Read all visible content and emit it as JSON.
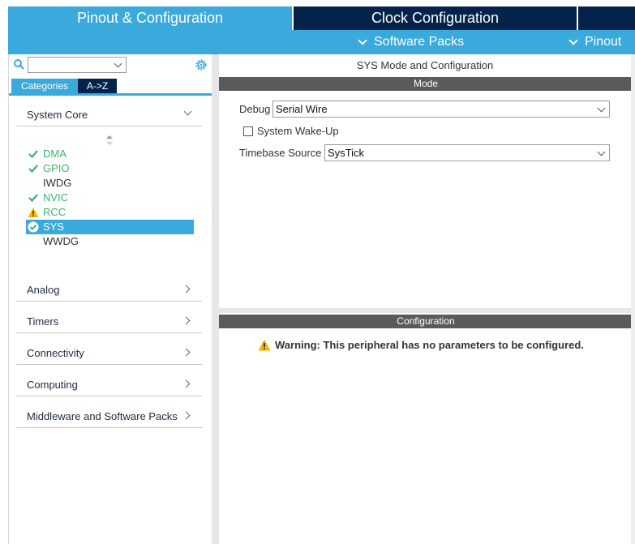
{
  "top_tabs": {
    "pinout": "Pinout & Configuration",
    "clock": "Clock Configuration"
  },
  "sub_menu": {
    "software_packs": "Software Packs",
    "pinout": "Pinout"
  },
  "left": {
    "search": {
      "value": ""
    },
    "tabs": {
      "categories": "Categories",
      "az": "A->Z"
    },
    "sections": {
      "system_core": "System Core",
      "analog": "Analog",
      "timers": "Timers",
      "connectivity": "Connectivity",
      "computing": "Computing",
      "middleware": "Middleware and Software Packs"
    },
    "peripherals": [
      {
        "name": "DMA",
        "status": "ok"
      },
      {
        "name": "GPIO",
        "status": "ok"
      },
      {
        "name": "IWDG",
        "status": "none"
      },
      {
        "name": "NVIC",
        "status": "ok"
      },
      {
        "name": "RCC",
        "status": "warning"
      },
      {
        "name": "SYS",
        "status": "selected-ok"
      },
      {
        "name": "WWDG",
        "status": "none"
      }
    ]
  },
  "right": {
    "title": "SYS Mode and Configuration",
    "mode_band": "Mode",
    "debug_label": "Debug",
    "debug_value": "Serial Wire",
    "wakeup_label": "System Wake-Up",
    "wakeup_checked": false,
    "timebase_label": "Timebase Source",
    "timebase_value": "SysTick",
    "config_band": "Configuration",
    "warning": "Warning: This peripheral has no parameters to be configured."
  },
  "colors": {
    "accent": "#3aa9db",
    "navy": "#03234b",
    "ok_green": "#3cb371",
    "warn_yellow": "#f2b705",
    "band_gray": "#5a5a5a"
  }
}
